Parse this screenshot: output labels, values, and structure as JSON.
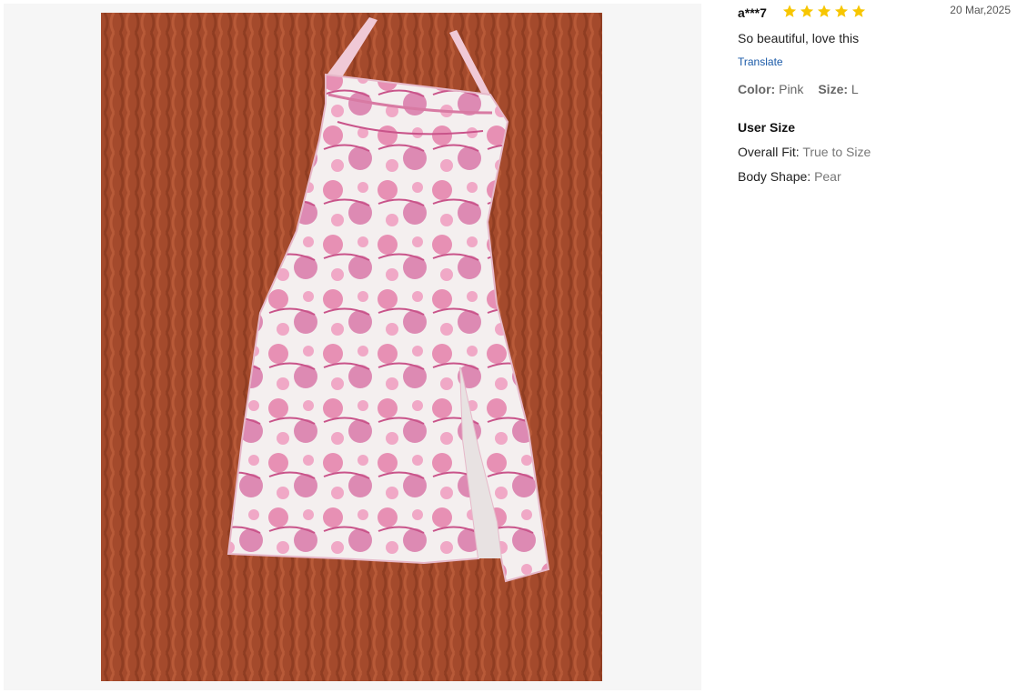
{
  "review": {
    "reviewer": "a***7",
    "rating": 5,
    "date": "20 Mar,2025",
    "comment": "So beautiful, love this",
    "translate_label": "Translate",
    "color_label": "Color:",
    "color_value": "Pink",
    "size_label": "Size:",
    "size_value": "L"
  },
  "user_size": {
    "title": "User Size",
    "overall_fit_label": "Overall Fit:",
    "overall_fit_value": "True to Size",
    "body_shape_label": "Body Shape:",
    "body_shape_value": "Pear"
  },
  "colors": {
    "star": "#f7c600",
    "link": "#1a5aa8",
    "blanket": "#a44a2c",
    "dress_pink": "#e57fa9",
    "dress_white": "#f4efef"
  },
  "icons": [
    "star-icon"
  ]
}
